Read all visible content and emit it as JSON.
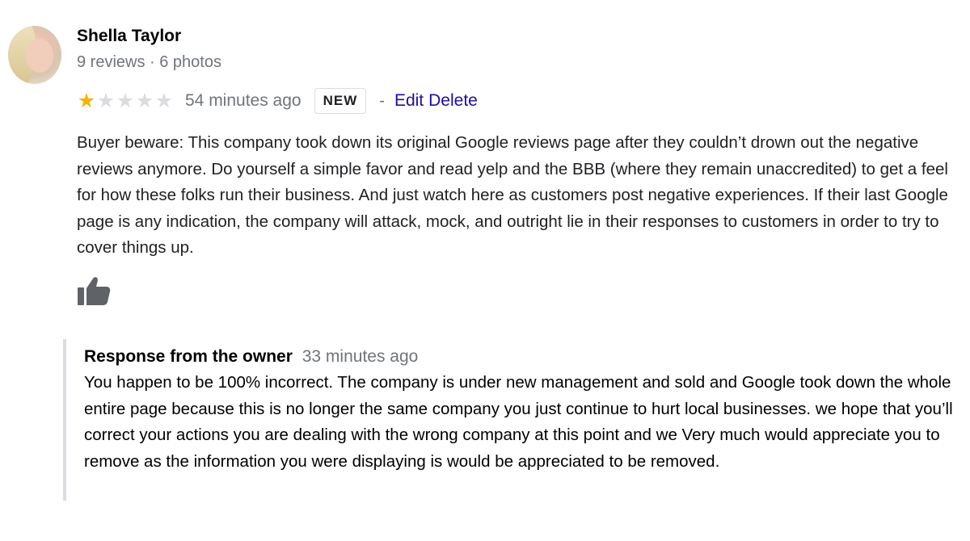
{
  "reviewer": {
    "name": "Shella Taylor",
    "meta": "9 reviews · 6 photos"
  },
  "rating": {
    "value": 1,
    "max": 5,
    "filled_color": "#f4b400",
    "empty_color": "#dadce0"
  },
  "review": {
    "time": "54 minutes ago",
    "badge": "NEW",
    "separator": "-",
    "edit_label": "Edit",
    "delete_label": "Delete",
    "text": "Buyer beware: This company took down its original Google reviews page after they couldn’t drown out the negative reviews anymore. Do yourself a simple favor and read yelp and the BBB (where they remain unaccredited) to get a feel for how these folks run their business. And just watch here as customers post negative experiences. If their last Google page is any indication, the company will attack, mock, and outright lie in their responses to customers in order to try to cover things up.",
    "like_icon": "thumbs-up-icon"
  },
  "owner_response": {
    "label": "Response from the owner",
    "time": "33 minutes ago",
    "text": "You happen to be 100% incorrect. The company is under new management and sold and Google took down the whole entire page because this is no longer the same company you just continue to hurt local businesses. we hope that you’ll correct your actions you are dealing with the wrong company at this point and we Very much would appreciate you to remove as the information you were displaying is would be appreciated to be removed."
  },
  "colors": {
    "link": "#1a0dab",
    "muted_text": "#70757a",
    "border": "#dadce0"
  }
}
